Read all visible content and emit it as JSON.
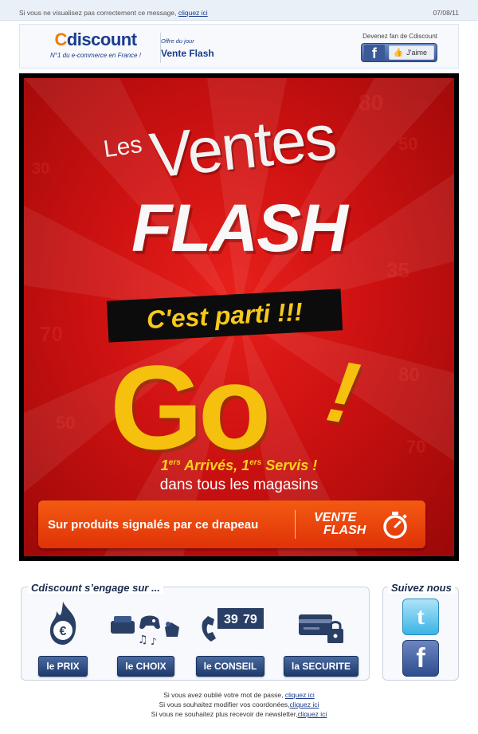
{
  "topbar": {
    "message": "Si vous ne visualisez pas correctement ce message, ",
    "link": "cliquez ici",
    "date": "07/08/11"
  },
  "header": {
    "logo_c": "C",
    "logo_rest": "discount",
    "tagline": "N°1 du e-commerce en France !",
    "offer_kicker": "Offre du jour",
    "offer_title": "Vente Flash",
    "fan_label": "Devenez fan de Cdiscount",
    "fb_letter": "f",
    "like_label": "J'aime"
  },
  "banner": {
    "les": "Les",
    "ventes": "Ventes",
    "flash": "FLASH",
    "parti": "C'est parti !!!",
    "go": "Go",
    "go_excl": "!",
    "arrives_sup1": "ers",
    "arrives_part1": "1",
    "arrives_word1": " Arrivés, ",
    "arrives_sup2": "ers",
    "arrives_part2": "1",
    "arrives_word2": " Servis !",
    "magasins": "dans tous les magasins",
    "flag_text": "Sur produits signalés par ce drapeau",
    "vf_line1": "VENTE",
    "vf_line2": "FLASH"
  },
  "engage": {
    "title": "Cdiscount s’engage sur ...",
    "items": [
      {
        "label": "le PRIX",
        "icon": "euro-flame-icon"
      },
      {
        "label": "le CHOIX",
        "icon": "products-icon"
      },
      {
        "label": "le CONSEIL",
        "icon": "phone-icon",
        "price_main": "39",
        "price_cents": "79"
      },
      {
        "label": "la SECURITE",
        "icon": "card-lock-icon"
      }
    ]
  },
  "follow": {
    "title": "Suivez nous",
    "twitter_icon": "twitter-icon",
    "facebook_icon": "facebook-icon",
    "t_glyph": "t",
    "f_glyph": "f"
  },
  "footer": {
    "line1": "Si vous avez oublié votre mot de passe, ",
    "line1_link": "cliquez ici",
    "line2": "Si vous souhaitez modifier vos coordonées,",
    "line2_link": "cliquez ici",
    "line3": "Si vous ne souhaitez plus recevoir de newsletter,",
    "line3_link": "cliquez ici"
  },
  "colors": {
    "brand_blue": "#1a3c8c",
    "brand_orange": "#f07d00",
    "banner_red": "#cc1111",
    "go_yellow": "#f6c10e"
  }
}
